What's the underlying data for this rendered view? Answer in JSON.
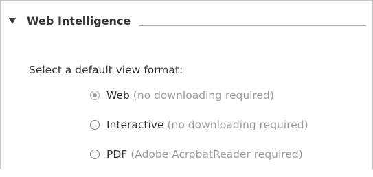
{
  "section": {
    "title": "Web Intelligence",
    "expanded": true,
    "toggle_icon": "triangle-down-icon"
  },
  "prompt": "Select a default view format:",
  "view_format_options": [
    {
      "label": "Web",
      "note": "(no downloading required)",
      "selected": true
    },
    {
      "label": "Interactive",
      "note": "(no downloading required)",
      "selected": false
    },
    {
      "label": "PDF",
      "note": "(Adobe AcrobatReader required)",
      "selected": false
    }
  ],
  "colors": {
    "text": "#333333",
    "note_text": "#9c9c9c",
    "border": "#c8c8c8",
    "header_rule": "#a8a8a8"
  }
}
